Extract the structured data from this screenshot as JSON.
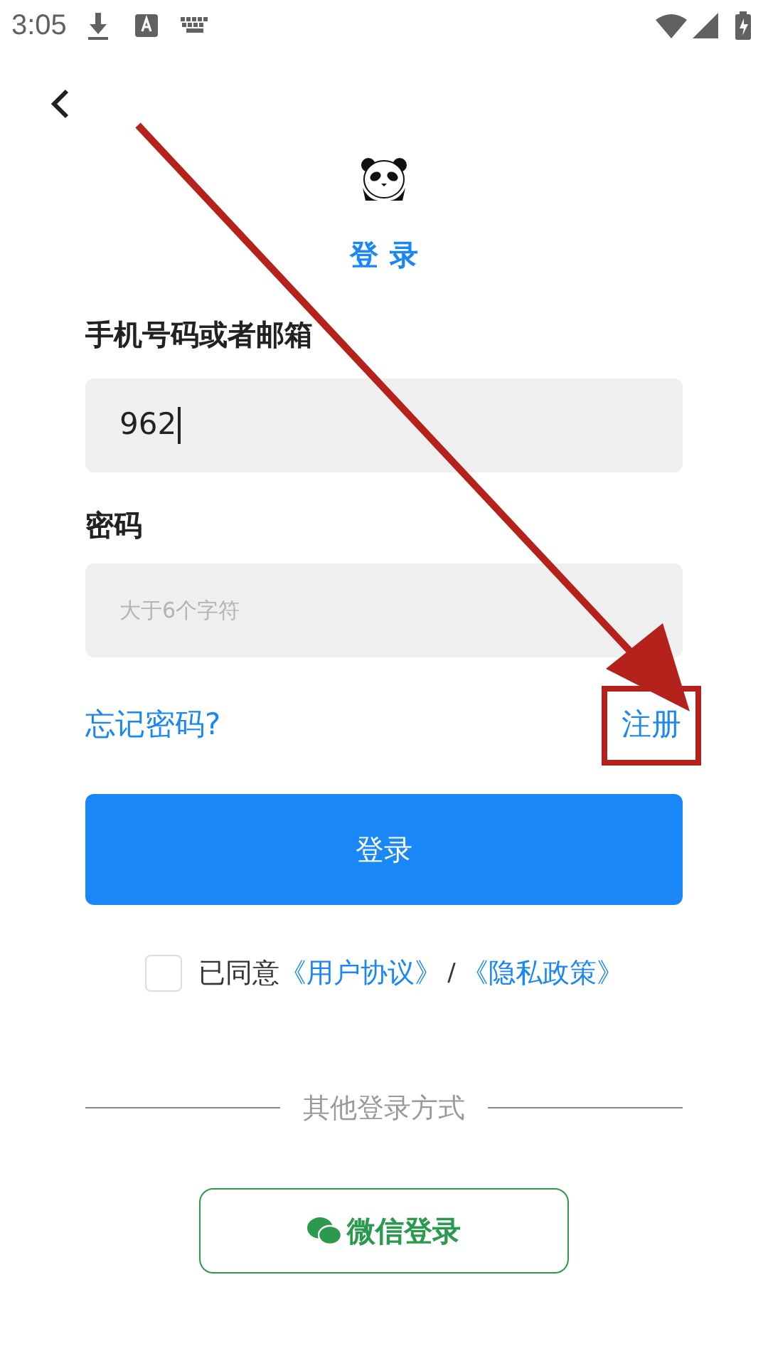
{
  "status_bar": {
    "time": "3:05"
  },
  "title": "登录",
  "account": {
    "label": "手机号码或者邮箱",
    "value": "962"
  },
  "password": {
    "label": "密码",
    "placeholder": "大于6个字符"
  },
  "forgot_link": "忘记密码?",
  "register_link": "注册",
  "login_button": "登录",
  "agreement": {
    "checked": false,
    "prefix": "已同意",
    "terms": "《用户协议》",
    "separator": "/",
    "privacy": "《隐私政策》"
  },
  "other_methods": "其他登录方式",
  "wechat_button": "微信登录",
  "annotation": {
    "arrow": true,
    "highlight_register": true
  }
}
